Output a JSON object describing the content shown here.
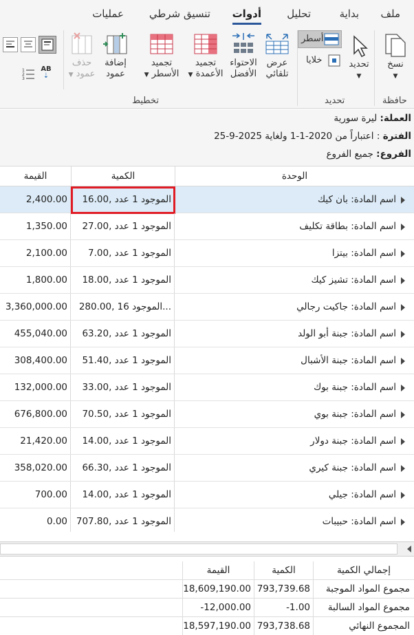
{
  "menu_tabs": [
    {
      "label": "ملف",
      "active": false
    },
    {
      "label": "بداية",
      "active": false
    },
    {
      "label": "تحليل",
      "active": false
    },
    {
      "label": "أدوات",
      "active": true
    },
    {
      "label": "تنسيق شرطي",
      "active": false
    },
    {
      "label": "عمليات",
      "active": false
    }
  ],
  "ribbon": {
    "copy": "نسخ",
    "select": "تحديد",
    "rows": "أسطر",
    "cells": "خلايا",
    "auto_view_1": "عرض",
    "auto_view_2": "تلقائي",
    "best_fit_1": "الاحتواء",
    "best_fit_2": "الأفضل",
    "freeze_cols_1": "تجميد",
    "freeze_cols_2": "الأعمدة",
    "freeze_rows_1": "تجميد",
    "freeze_rows_2": "الأسطر",
    "add_col_1": "إضافة",
    "add_col_2": "عمود",
    "del_col_1": "حذف",
    "del_col_2": "عمود",
    "group_clipboard": "حافظة",
    "group_select": "تحديد",
    "group_layout": "تخطيط",
    "ab_icon_text": "AB"
  },
  "info": {
    "currency_label": "العملة:",
    "currency_value": "ليرة سورية",
    "period_label": "الفترة",
    "period_value": ": اعتباراً من 2020-1-1 ولغاية 2025-9-25",
    "branches_label": "الفروع:",
    "branches_value": "جميع الفروع"
  },
  "grid": {
    "headers": {
      "unit": "الوحدة",
      "qty": "الكمية",
      "value": "القيمة"
    },
    "rows": [
      {
        "unit": "اسم المادة: بان كيك",
        "qty": "16.00, الموجود 1 عدد",
        "value": "2,400.00"
      },
      {
        "unit": "اسم المادة: بطاقة تكليف",
        "qty": "27.00, الموجود 1 عدد",
        "value": "1,350.00"
      },
      {
        "unit": "اسم المادة: بيتزا",
        "qty": "7.00, الموجود 1 عدد",
        "value": "2,100.00"
      },
      {
        "unit": "اسم المادة: تشيز كيك",
        "qty": "18.00, الموجود 1 عدد",
        "value": "1,800.00"
      },
      {
        "unit": "اسم المادة: جاكيت رجالي",
        "qty": "280.00, الموجود 16...",
        "value": "3,360,000.00"
      },
      {
        "unit": "اسم المادة: جبنة أبو الولد",
        "qty": "63.20, الموجود 1 عدد",
        "value": "455,040.00"
      },
      {
        "unit": "اسم المادة: جبنة الأشبال",
        "qty": "51.40, الموجود 1 عدد",
        "value": "308,400.00"
      },
      {
        "unit": "اسم المادة: جبنة بوك",
        "qty": "33.00, الموجود 1 عدد",
        "value": "132,000.00"
      },
      {
        "unit": "اسم المادة: جبنة بوي",
        "qty": "70.50, الموجود 1 عدد",
        "value": "676,800.00"
      },
      {
        "unit": "اسم المادة: جبنة دولار",
        "qty": "14.00, الموجود 1 عدد",
        "value": "21,420.00"
      },
      {
        "unit": "اسم المادة: جبنة كيري",
        "qty": "66.30, الموجود 1 عدد",
        "value": "358,020.00"
      },
      {
        "unit": "اسم المادة: جيلي",
        "qty": "14.00, الموجود 1 عدد",
        "value": "700.00"
      },
      {
        "unit": "اسم المادة: حبيبات",
        "qty": "707.80, الموجود 1 عدد",
        "value": "0.00"
      }
    ]
  },
  "totals": {
    "headers": {
      "label": "إجمالي الكمية",
      "qty": "الكمية",
      "value": "القيمة"
    },
    "rows": [
      {
        "label": "مجموع المواد الموجبة",
        "qty": "793,739.68",
        "value": "18,609,190.00"
      },
      {
        "label": "مجموع المواد السالبة",
        "qty": "-1.00",
        "value": "-12,000.00"
      },
      {
        "label": "المجموع النهائي",
        "qty": "793,738.68",
        "value": "18,597,190.00"
      }
    ]
  },
  "colors": {
    "accent": "#2b579a",
    "highlight": "#e01b24",
    "selected_row": "#dcebf7"
  }
}
